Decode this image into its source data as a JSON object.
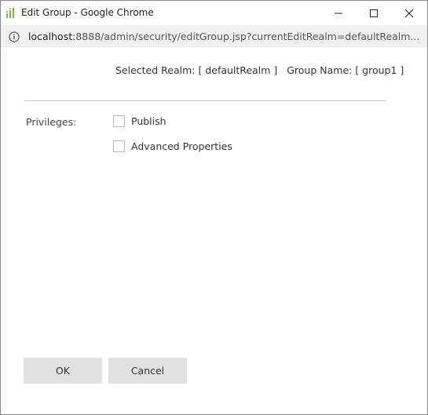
{
  "window": {
    "title": "Edit Group - Google Chrome",
    "controls": {
      "minimize": "minimize-icon",
      "maximize": "maximize-icon",
      "close": "close-icon"
    }
  },
  "address": {
    "host": "localhost",
    "rest": ":8888/admin/security/editGroup.jsp?currentEditRealm=defaultRealm..."
  },
  "form": {
    "realm_label": "Selected Realm: [ defaultRealm ]",
    "group_label": "Group Name: [ group1 ]",
    "privileges_label": "Privileges:",
    "privileges": [
      {
        "label": "Publish",
        "checked": false
      },
      {
        "label": "Advanced Properties",
        "checked": false
      }
    ]
  },
  "buttons": {
    "ok": "OK",
    "cancel": "Cancel"
  }
}
